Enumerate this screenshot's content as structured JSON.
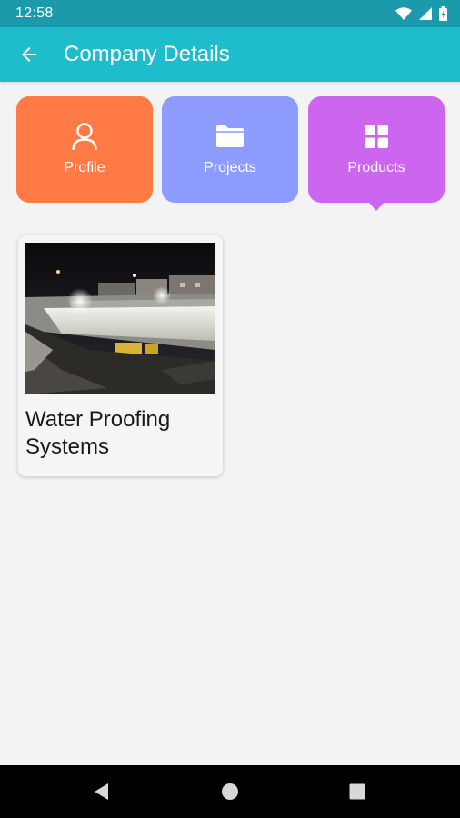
{
  "status_bar": {
    "time": "12:58",
    "icons": [
      "wifi-icon",
      "signal-icon",
      "battery-icon"
    ]
  },
  "app_bar": {
    "title": "Company Details",
    "back_icon": "arrow-left-icon"
  },
  "tabs": [
    {
      "label": "Profile",
      "icon": "person-icon",
      "color": "#ff7a45"
    },
    {
      "label": "Projects",
      "icon": "folder-icon",
      "color": "#8f9cff"
    },
    {
      "label": "Products",
      "icon": "grid-icon",
      "color": "#cc66ee",
      "selected": true
    }
  ],
  "products": [
    {
      "title": "Water Proofing Systems"
    }
  ],
  "nav_bar": {
    "buttons": [
      "back-triangle-icon",
      "home-circle-icon",
      "recents-square-icon"
    ]
  },
  "colors": {
    "status_bar": "#1a9aaa",
    "app_bar": "#1fbccc",
    "background": "#f3f3f3"
  }
}
